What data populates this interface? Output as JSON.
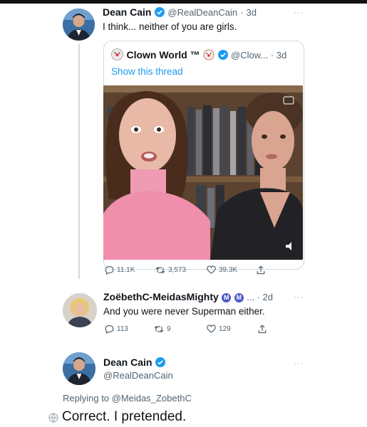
{
  "tweet1": {
    "name": "Dean Cain",
    "handle": "@RealDeanCain",
    "time": "· 3d",
    "text": "I think... neither of you are girls."
  },
  "quoted": {
    "name": "Clown World ™",
    "handle": "@Clow... · 3d",
    "show_thread": "Show this thread",
    "metrics": {
      "replies": "11.1K",
      "retweets": "3,573",
      "likes": "39.3K"
    }
  },
  "tweet2": {
    "name": "ZoëbethC-MeidasMighty",
    "badge": "M",
    "after_badges": "... · 2d",
    "text": "And you were never Superman either.",
    "metrics": {
      "replies": "113",
      "retweets": "9",
      "likes": "129"
    }
  },
  "tweet3": {
    "name": "Dean Cain",
    "handle": "@RealDeanCain",
    "replying": "Replying to @Meidas_ZobethC",
    "text": "Correct. I pretended."
  },
  "more_label": "···",
  "colors": {
    "verified": "#1d9bf0",
    "link": "#1d9bf0",
    "muted": "#536471",
    "badge": "#4a58c9"
  }
}
